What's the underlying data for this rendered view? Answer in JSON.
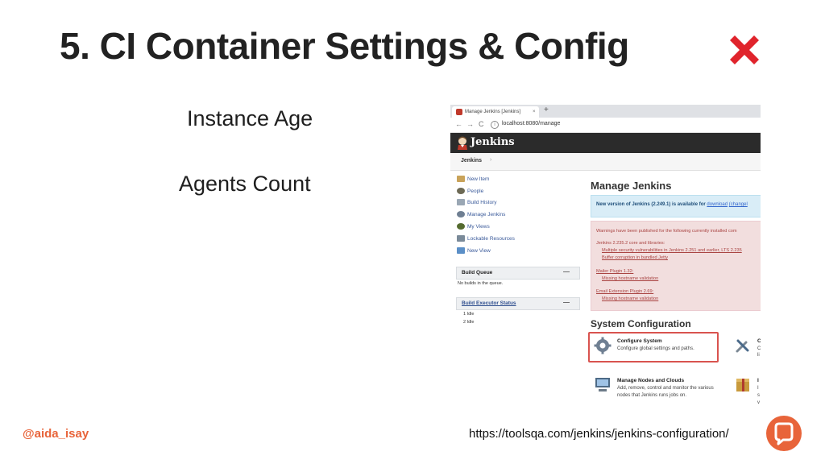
{
  "slide": {
    "title": "5. CI Container Settings & Config",
    "title_icon": "cross-mark-icon",
    "bullets": [
      "Instance Age",
      "Agents Count"
    ],
    "handle": "@aida_isay",
    "source_url": "https://toolsqa.com/jenkins/jenkins-configuration/",
    "accent_color": "#e8643a"
  },
  "browser": {
    "tab_title": "Manage Jenkins [Jenkins]",
    "tab_close": "×",
    "new_tab": "+",
    "back": "←",
    "forward": "→",
    "reload": "C",
    "info": "i",
    "url": "localhost:8080/manage"
  },
  "jenkins": {
    "app_title": "Jenkins",
    "breadcrumb": "Jenkins",
    "breadcrumb_arrow": "›",
    "sidebar": [
      "New Item",
      "People",
      "Build History",
      "Manage Jenkins",
      "My Views",
      "Lockable Resources",
      "New View"
    ],
    "build_queue": {
      "title": "Build Queue",
      "toggle": "—",
      "empty": "No builds in the queue."
    },
    "executor_status": {
      "title": "Build Executor Status",
      "toggle": "—",
      "items": [
        "1  Idle",
        "2  Idle"
      ]
    },
    "page_title": "Manage Jenkins",
    "info": {
      "prefix": "New version of Jenkins (2.249.1) is available for",
      "link1": "download",
      "link2": "(changel"
    },
    "warnings": {
      "intro": "Warnings have been published for the following currently installed com",
      "core_label": "Jenkins 2.235.2 core and libraries:",
      "core_1": "Multiple security vulnerabilities in Jenkins 2.251 and earlier, LTS 2.235",
      "core_2": "Buffer corruption in bundled Jetty",
      "mailer_label": "Mailer Plugin 1.32:",
      "mailer_1": "Missing hostname validation",
      "email_label": "Email Extension Plugin 2.69:",
      "email_1": "Missing hostname validation"
    },
    "system_config_title": "System Configuration",
    "configure_system": {
      "title": "Configure System",
      "desc": "Configure global settings and paths."
    },
    "global_tools_cut": {
      "title": "C",
      "desc1": "C",
      "desc2": "li"
    },
    "manage_nodes": {
      "title": "Manage Nodes and Clouds",
      "desc1": "Add, remove, control and monitor the various",
      "desc2": "nodes that Jenkins runs jobs on."
    },
    "plugins_cut": {
      "title": "I",
      "desc1": "I",
      "desc2": "s",
      "desc3": "v"
    }
  }
}
